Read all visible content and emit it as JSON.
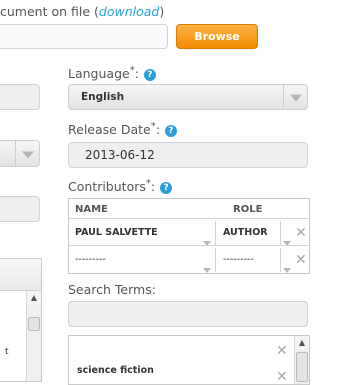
{
  "upload": {
    "text_prefix": "cument on file (",
    "download_link": "download",
    "text_suffix": ")",
    "browse_label": "Browse"
  },
  "language": {
    "label": "Language",
    "required_mark": "*",
    "colon": ":",
    "help_icon": "?",
    "value": "English"
  },
  "release_date": {
    "label": "Release Date",
    "required_mark": "*",
    "colon": ":",
    "help_icon": "?",
    "value": "2013-06-12"
  },
  "contributors": {
    "label": "Contributors",
    "required_mark": "*",
    "colon": ":",
    "help_icon": "?",
    "columns": [
      "NAME",
      "ROLE"
    ],
    "rows": [
      {
        "name": "PAUL SALVETTE",
        "role": "AUTHOR"
      },
      {
        "name": "---------",
        "role": "---------"
      }
    ]
  },
  "search_terms": {
    "label": "Search Terms:",
    "input_value": "",
    "tags": [
      "science fiction"
    ]
  },
  "left_panel": {
    "fragment_text": "t"
  },
  "colors": {
    "accent": "#2a9fd6",
    "browse": "#f5a623",
    "link": "#2a9fd6"
  }
}
